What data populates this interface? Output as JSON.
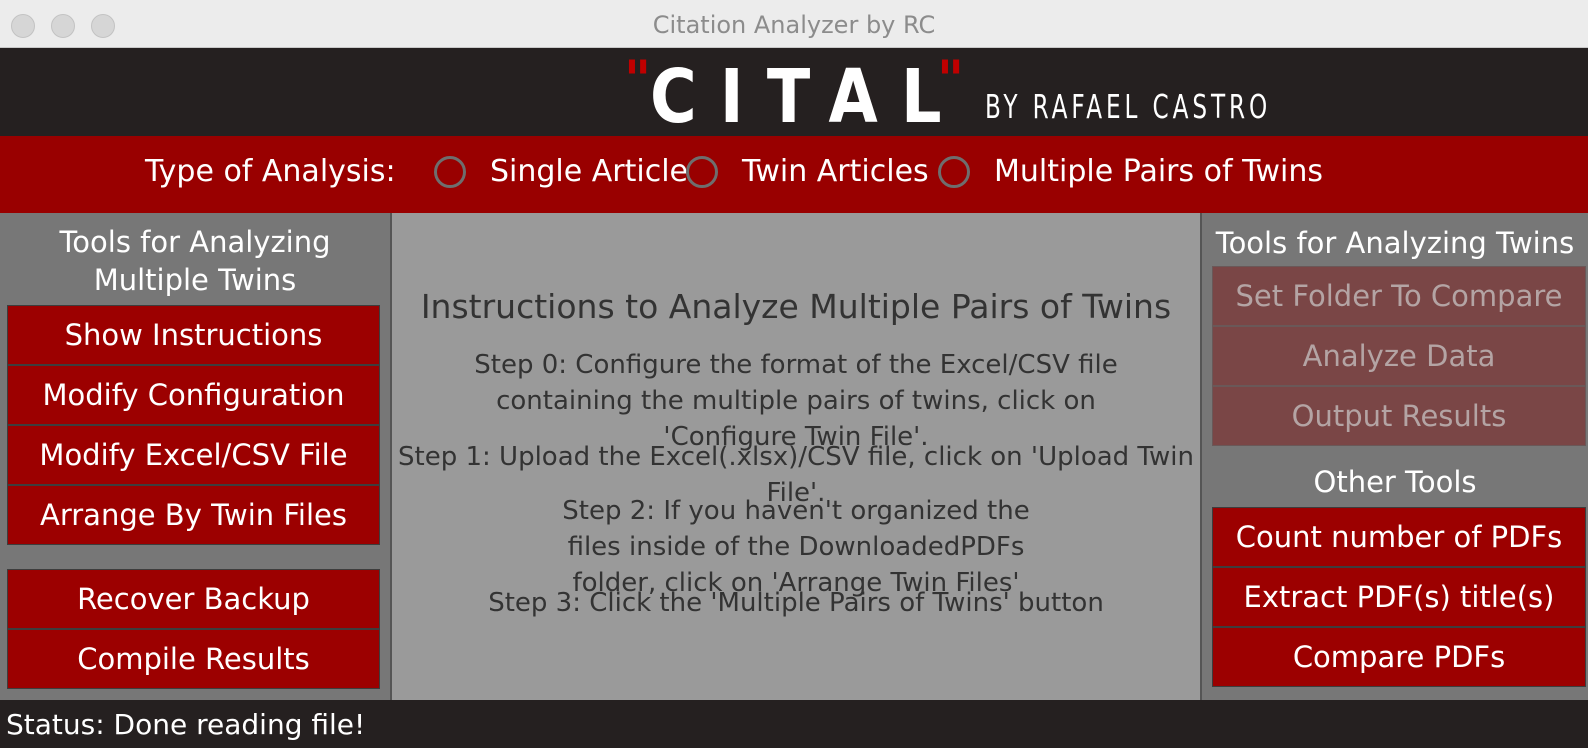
{
  "window": {
    "title": "Citation Analyzer by RC"
  },
  "banner": {
    "logo_text": "CITAL",
    "quote_open": "\"",
    "quote_close": "\"",
    "byline": "BY RAFAEL CASTRO"
  },
  "analysis": {
    "label": "Type of Analysis:",
    "options": [
      {
        "label": "Single Article",
        "selected": false
      },
      {
        "label": "Twin Articles",
        "selected": false
      },
      {
        "label": "Multiple Pairs of Twins",
        "selected": false
      }
    ]
  },
  "left_panel": {
    "heading": "Tools for Analyzing Multiple Twins",
    "buttons": [
      "Show Instructions",
      "Modify Configuration",
      "Modify Excel/CSV File",
      "Arrange By Twin Files",
      "Recover Backup",
      "Compile Results"
    ]
  },
  "instructions": {
    "title": "Instructions to Analyze Multiple Pairs of Twins",
    "steps": [
      "Step 0: Configure the format of the Excel/CSV file containing the multiple pairs of twins, click on 'Configure Twin File'.",
      "Step 1: Upload the Excel(.xlsx)/CSV file, click on 'Upload Twin File'.",
      "Step 2: If you haven't organized the files inside of the DownloadedPDFs folder, click on 'Arrange Twin Files'",
      "Step 3: Click the 'Multiple Pairs of Twins' button"
    ]
  },
  "right_panel": {
    "heading": "Tools for Analyzing Twins",
    "twin_buttons": [
      "Set Folder To Compare",
      "Analyze Data",
      "Output Results"
    ],
    "other_heading": "Other Tools",
    "other_buttons": [
      "Count number of PDFs",
      "Extract PDF(s) title(s)",
      "Compare PDFs"
    ]
  },
  "status": {
    "text": "Status: Done reading file!"
  },
  "colors": {
    "accent": "#990000",
    "button": "#9c0000",
    "panel": "#777777",
    "dark": "#252020"
  }
}
